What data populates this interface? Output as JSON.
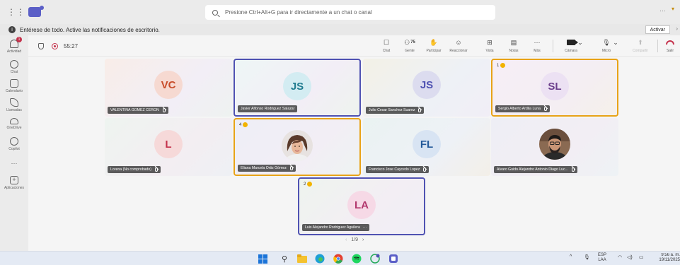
{
  "titlebar": {
    "search_placeholder": "Presione Ctrl+Alt+G para ir directamente a un chat o canal",
    "more": "···"
  },
  "notification": {
    "text": "Entérese de todo. Active las notificaciones de escritorio.",
    "button": "Activar"
  },
  "rail": {
    "items": [
      {
        "label": "Actividad",
        "icon": "bell-icon",
        "badge": "1"
      },
      {
        "label": "Chat",
        "icon": "chat-icon"
      },
      {
        "label": "Calendario",
        "icon": "calendar-icon"
      },
      {
        "label": "Llamadas",
        "icon": "phone-icon"
      },
      {
        "label": "OneDrive",
        "icon": "cloud-icon"
      },
      {
        "label": "Copilot",
        "icon": "copilot-icon"
      },
      {
        "label": "···",
        "icon": "more-icon"
      },
      {
        "label": "Aplicaciones",
        "icon": "add-app-icon"
      }
    ]
  },
  "meeting": {
    "timer": "55:27",
    "controls": {
      "chat": "Chat",
      "people": "Gente",
      "people_count": "75",
      "raise": "Participar",
      "react": "Reaccionar",
      "view": "Vista",
      "notes": "Notas",
      "more": "Más",
      "camera": "Cámara",
      "mic": "Micro",
      "share": "Compartir",
      "leave": "Salir"
    }
  },
  "participants": [
    {
      "initials": "VC",
      "name": "VALENTINA GOMEZ CERON",
      "muted": true,
      "avatar_bg": "#f6d9d1",
      "avatar_fg": "#c84c2a"
    },
    {
      "initials": "JS",
      "name": "Javier Alfonso Rodriguez Salazar",
      "muted": false,
      "avatar_bg": "#d3ecf2",
      "avatar_fg": "#1f7b8f"
    },
    {
      "initials": "JS",
      "name": "Julio Cesar Sanchez Suarez",
      "muted": true,
      "avatar_bg": "#dcdcef",
      "avatar_fg": "#4f52b2"
    },
    {
      "initials": "SL",
      "name": "Sergio Alberto Ardila Luna",
      "muted": true,
      "avatar_bg": "#ece1f3",
      "avatar_fg": "#6b3f8c",
      "hand": "1"
    },
    {
      "initials": "L",
      "name": "Lorena (No comprobado)",
      "muted": true,
      "avatar_bg": "#f6d9d9",
      "avatar_fg": "#c4314b"
    },
    {
      "initials": "",
      "name": "Eliana Marcela Ortiz Gómez",
      "muted": true,
      "photo": "woman",
      "hand": "4"
    },
    {
      "initials": "FL",
      "name": "Francisco Jose Caycedo Lopez",
      "muted": true,
      "avatar_bg": "#d8e4f3",
      "avatar_fg": "#245a9a"
    },
    {
      "initials": "",
      "name": "Alvaro Guido Alejandro Antonio Diago Luc...",
      "muted": true,
      "photo": "man"
    },
    {
      "initials": "LA",
      "name": "Luis Alejandro Rodriguez Aguilera",
      "muted": false,
      "more": "···",
      "avatar_bg": "#f6d9e6",
      "avatar_fg": "#b2376d",
      "hand": "2"
    }
  ],
  "pager": "1/9",
  "taskbar": {
    "lang_top": "ESP",
    "lang_bottom": "LAA",
    "time": "9:56 a. m.",
    "date": "19/11/2025"
  }
}
